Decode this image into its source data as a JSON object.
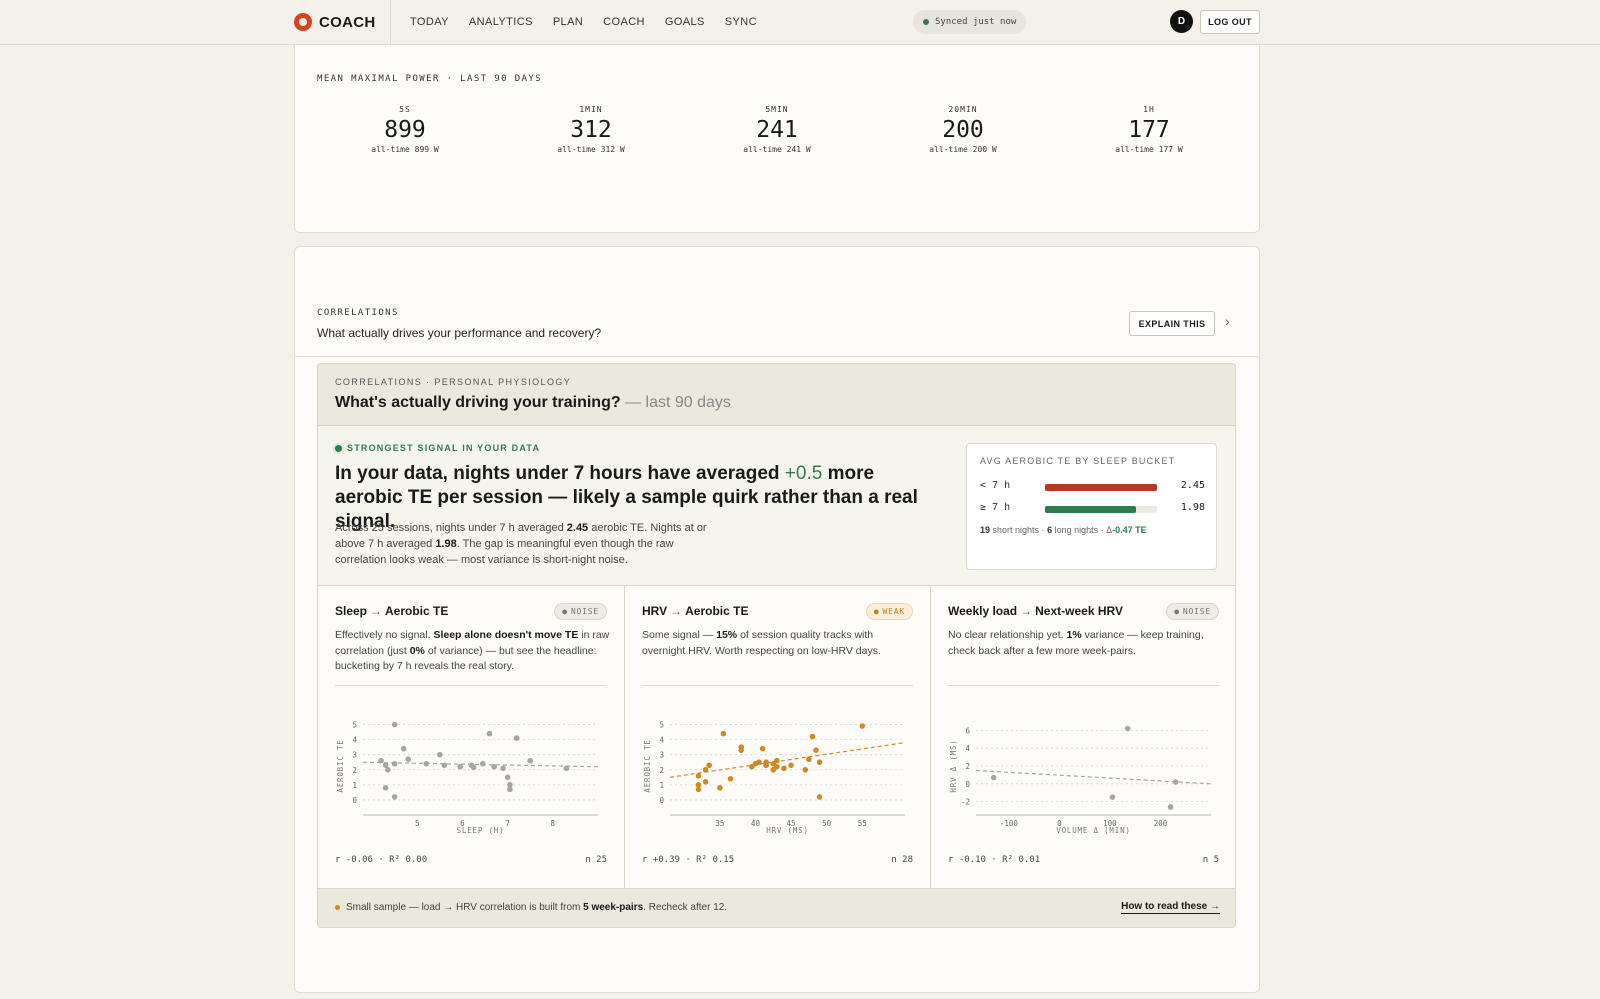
{
  "app": {
    "name": "COACH"
  },
  "nav": {
    "items": [
      "TODAY",
      "ANALYTICS",
      "PLAN",
      "COACH",
      "GOALS",
      "SYNC"
    ]
  },
  "sync_status": "Synced just now",
  "user": {
    "initial": "D",
    "logout_label": "LOG OUT"
  },
  "mmp": {
    "title": "MEAN MAXIMAL POWER · LAST 90 DAYS",
    "items": [
      {
        "label": "5S",
        "value": "899",
        "sub": "all-time 899 W"
      },
      {
        "label": "1MIN",
        "value": "312",
        "sub": "all-time 312 W"
      },
      {
        "label": "5MIN",
        "value": "241",
        "sub": "all-time 241 W"
      },
      {
        "label": "20MIN",
        "value": "200",
        "sub": "all-time 200 W"
      },
      {
        "label": "1H",
        "value": "177",
        "sub": "all-time 177 W"
      }
    ]
  },
  "correlations": {
    "eyebrow": "CORRELATIONS",
    "question": "What actually drives your performance and recovery?",
    "explain_label": "EXPLAIN THIS",
    "panel": {
      "eyebrow": "CORRELATIONS · PERSONAL PHYSIOLOGY",
      "title": "What's actually driving your training?",
      "title_suffix": "— last 90 days"
    },
    "signal": {
      "tag": "STRONGEST SIGNAL IN YOUR DATA",
      "headline_pre": "In your data, nights under 7 hours have averaged",
      "headline_delta": "+0.5",
      "headline_post": "more aerobic TE per session — likely a sample quirk rather than a real signal.",
      "body_1": "Across 25 sessions, nights under 7 h averaged",
      "body_val1": "2.45",
      "body_2": "aerobic TE. Nights at or above 7 h averaged",
      "body_val2": "1.98",
      "body_3": ". The gap is meaningful even though the raw correlation looks weak — most variance is short-night noise."
    },
    "bucket": {
      "title": "AVG AEROBIC TE BY SLEEP BUCKET",
      "rows": [
        {
          "label": "< 7 h",
          "value": "2.45",
          "fraction": 1.0,
          "color": "#b63a22"
        },
        {
          "label": "≥ 7 h",
          "value": "1.98",
          "fraction": 0.81,
          "color": "#2e7d4f"
        }
      ],
      "short_nights": "19",
      "short_label": "short nights ·",
      "long_nights": "6",
      "long_label": "long nights · Δ",
      "delta": "-0.47 TE"
    },
    "columns": [
      {
        "from": "Sleep",
        "to": "Aerobic TE",
        "badge": "NOISE",
        "body_1": "Effectively no signal.",
        "body_b1": "Sleep alone doesn't move TE",
        "body_2": "in raw correlation (just",
        "body_b2": "0%",
        "body_3": "of variance) — but see the headline: bucketing by 7 h reveals the real story.",
        "stats": "r -0.06 · R² 0.00",
        "n": "n 25"
      },
      {
        "from": "HRV",
        "to": "Aerobic TE",
        "badge": "WEAK",
        "body_1": "Some signal —",
        "body_b1": "15%",
        "body_2": "of session quality tracks with overnight HRV. Worth respecting on low-HRV days.",
        "stats": "r +0.39 · R² 0.15",
        "n": "n 28"
      },
      {
        "from": "Weekly load",
        "to": "Next-week HRV",
        "badge": "NOISE",
        "body_1": "No clear relationship yet.",
        "body_b1": "1%",
        "body_2": "variance — keep training, check back after a few more week-pairs.",
        "stats": "r -0.10 · R² 0.01",
        "n": "n 5"
      }
    ],
    "footnote": {
      "text_1": "Small sample — load → HRV correlation is built from",
      "text_b": "5 week-pairs",
      "text_2": ". Recheck after 12.",
      "link": "How to read these →"
    }
  },
  "chart_data": [
    {
      "type": "scatter",
      "xlabel": "SLEEP (H)",
      "ylabel": "AEROBIC TE",
      "xlim": [
        3.8,
        9.0
      ],
      "ylim": [
        -1,
        5.5
      ],
      "x_ticks": [
        "5",
        "6",
        "7",
        "8"
      ],
      "y_ticks": [
        "0",
        "1",
        "2",
        "3",
        "4",
        "5"
      ],
      "trend": [
        [
          3.8,
          2.5
        ],
        [
          9.0,
          2.2
        ]
      ],
      "points": [
        [
          4.5,
          5.0
        ],
        [
          4.7,
          3.4
        ],
        [
          4.2,
          2.6
        ],
        [
          4.3,
          2.3
        ],
        [
          4.35,
          2.0
        ],
        [
          4.5,
          2.4
        ],
        [
          4.3,
          0.8
        ],
        [
          4.5,
          0.2
        ],
        [
          4.8,
          2.7
        ],
        [
          5.2,
          2.4
        ],
        [
          5.5,
          3.0
        ],
        [
          5.6,
          2.3
        ],
        [
          5.95,
          2.2
        ],
        [
          6.2,
          2.3
        ],
        [
          6.45,
          2.4
        ],
        [
          6.6,
          4.4
        ],
        [
          6.7,
          2.2
        ],
        [
          6.9,
          2.1
        ],
        [
          7.0,
          1.5
        ],
        [
          7.05,
          1.0
        ],
        [
          7.05,
          0.7
        ],
        [
          7.2,
          4.1
        ],
        [
          7.5,
          2.6
        ],
        [
          8.3,
          2.1
        ],
        [
          6.25,
          2.15
        ]
      ],
      "color": "#a8a59d"
    },
    {
      "type": "scatter",
      "xlabel": "HRV (MS)",
      "ylabel": "AEROBIC TE",
      "xlim": [
        28,
        61
      ],
      "ylim": [
        -1,
        5.5
      ],
      "x_ticks": [
        "35",
        "40",
        "45",
        "50",
        "55"
      ],
      "y_ticks": [
        "0",
        "1",
        "2",
        "3",
        "4",
        "5"
      ],
      "trend": [
        [
          28,
          1.5
        ],
        [
          61,
          3.8
        ]
      ],
      "points": [
        [
          32,
          0.7
        ],
        [
          32,
          1.0
        ],
        [
          32,
          1.6
        ],
        [
          33,
          1.2
        ],
        [
          33,
          2.0
        ],
        [
          33.5,
          2.3
        ],
        [
          35,
          0.8
        ],
        [
          35.5,
          4.4
        ],
        [
          36.5,
          1.4
        ],
        [
          38,
          3.3
        ],
        [
          38,
          3.5
        ],
        [
          39.5,
          2.2
        ],
        [
          40,
          2.4
        ],
        [
          40.5,
          2.5
        ],
        [
          41,
          3.4
        ],
        [
          41.5,
          2.3
        ],
        [
          41.5,
          2.5
        ],
        [
          42.5,
          2.0
        ],
        [
          43,
          2.6
        ],
        [
          43,
          2.2
        ],
        [
          44,
          2.1
        ],
        [
          45,
          2.3
        ],
        [
          47,
          2.0
        ],
        [
          47.5,
          2.7
        ],
        [
          48,
          4.2
        ],
        [
          48.5,
          3.3
        ],
        [
          49,
          2.5
        ],
        [
          49,
          0.2
        ],
        [
          55,
          4.9
        ],
        [
          42.5,
          2.4
        ]
      ],
      "color": "#d08a25"
    },
    {
      "type": "scatter",
      "xlabel": "VOLUME Δ (MIN)",
      "ylabel": "HRV Δ (MS)",
      "xlim": [
        -165,
        300
      ],
      "ylim": [
        -3.5,
        7.5
      ],
      "x_ticks": [
        "-100",
        "0",
        "100",
        "200"
      ],
      "y_ticks": [
        "-2",
        "0",
        "2",
        "4",
        "6"
      ],
      "trend": [
        [
          -165,
          1.5
        ],
        [
          300,
          0.0
        ]
      ],
      "points": [
        [
          -130,
          0.7
        ],
        [
          105,
          -1.5
        ],
        [
          135,
          6.2
        ],
        [
          220,
          -2.6
        ],
        [
          230,
          0.2
        ]
      ],
      "color": "#a8a59d"
    }
  ]
}
